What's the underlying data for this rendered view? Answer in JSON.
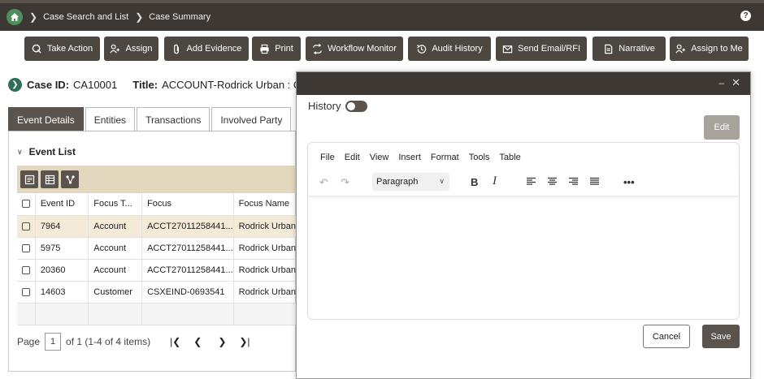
{
  "nav": {
    "breadcrumb": [
      "Case Search and List",
      "Case Summary"
    ],
    "help": "?"
  },
  "toolbar": [
    {
      "label": "Take Action",
      "icon": "take-action-icon"
    },
    {
      "label": "Assign",
      "icon": "assign-icon"
    },
    {
      "label": "Add Evidence",
      "icon": "paperclip-icon"
    },
    {
      "label": "Print",
      "icon": "printer-icon"
    },
    {
      "label": "Workflow Monitor",
      "icon": "workflow-icon"
    },
    {
      "label": "Audit History",
      "icon": "history-icon"
    },
    {
      "label": "Send Email/RFI",
      "icon": "mail-icon"
    },
    {
      "label": "Narrative",
      "icon": "document-icon"
    },
    {
      "label": "Assign to Me",
      "icon": "assign-me-icon"
    }
  ],
  "case": {
    "id_label": "Case ID:",
    "id_value": "CA10001",
    "title_label": "Title:",
    "title_value": "ACCOUNT-Rodrick Urban : CUST"
  },
  "tabs": [
    "Event Details",
    "Entities",
    "Transactions",
    "Involved Party"
  ],
  "event_list": {
    "title": "Event List",
    "columns": [
      "Event ID",
      "Focus T...",
      "Focus",
      "Focus Name"
    ],
    "rows": [
      [
        "7964",
        "Account",
        "ACCT27011258441...",
        "Rodrick Urban"
      ],
      [
        "5975",
        "Account",
        "ACCT27011258441...",
        "Rodrick Urban"
      ],
      [
        "20360",
        "Account",
        "ACCT27011258441...",
        "Rodrick Urban"
      ],
      [
        "14603",
        "Customer",
        "CSXEIND-0693541",
        "Rodrick Urban"
      ]
    ],
    "pager": {
      "label": "Page",
      "page": "1",
      "summary": "of 1 (1-4 of 4 items)"
    }
  },
  "dialog": {
    "history_label": "History",
    "edit_label": "Edit",
    "menu": [
      "File",
      "Edit",
      "View",
      "Insert",
      "Format",
      "Tools",
      "Table"
    ],
    "paragraph": "Paragraph",
    "cancel_label": "Cancel",
    "save_label": "Save"
  }
}
